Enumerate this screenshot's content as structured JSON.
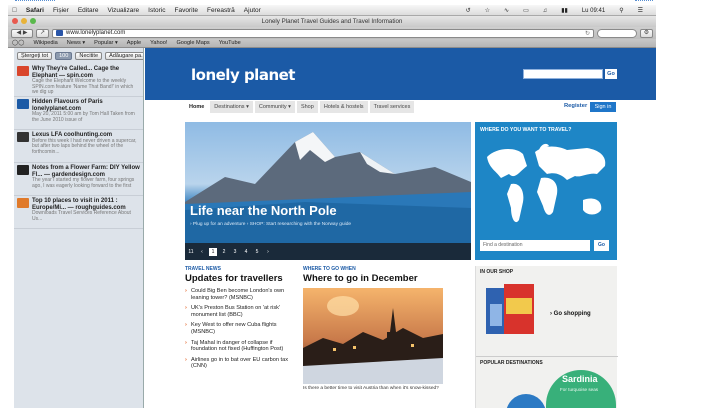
{
  "menubar": {
    "app": "Safari",
    "items": [
      "Fișier",
      "Editare",
      "Vizualizare",
      "Istoric",
      "Favorite",
      "Fereastră",
      "Ajutor"
    ],
    "clock": "Lu 09:41"
  },
  "window": {
    "title": "Lonely Planet Travel Guides and Travel Information"
  },
  "toolbar": {
    "url": "www.lonelyplanet.com"
  },
  "bookmarks": [
    "Wikipedia",
    "News ▾",
    "Popular ▾",
    "Apple",
    "Yahoo!",
    "Google Maps",
    "YouTube"
  ],
  "sidebar": {
    "clear_label": "Ștergeți tot",
    "count": "100",
    "unread_label": "Necitite",
    "add_label": "Adăugare pa...",
    "items": [
      {
        "title": "Why They're Called... Cage the Elephant — spin.com",
        "desc": "Cage the Elephant Welcome to the weekly SPIN.com feature 'Name That Band!' in which we dig up",
        "color": "#d9462c"
      },
      {
        "title": "Hidden Flavours of Paris lonelyplanet.com",
        "desc": "May 20, 2011 5:00 am by Tom Hall Taken from the June 2010 issue of",
        "color": "#1b5aa6"
      },
      {
        "title": "Lexus LFA coolhunting.com",
        "desc": "Before this week I had never driven a supercar, but after two laps behind the wheel of the forthcomin...",
        "color": "#333333"
      },
      {
        "title": "Notes from a Flower Farm: DIY Yellow Fl... — gardendesign.com",
        "desc": "The year I started my flower farm, four springs ago, I was eagerly looking forward to the first",
        "color": "#222222"
      },
      {
        "title": "Top 10 places to visit in 2011 : Europe/Mi... — roughguides.com",
        "desc": "Downloads Travel Services Reference About Us...",
        "color": "#e07a2a"
      }
    ]
  },
  "lp": {
    "logo": "lonely planet",
    "go": "Go",
    "nav": [
      "Home",
      "Destinations ▾",
      "Community ▾",
      "Shop",
      "Hotels & hostels",
      "Travel services"
    ],
    "register": "Register",
    "signin": "Sign in",
    "hero_title": "Life near the North Pole",
    "hero_sub": "› Plug up for an adventure   › SHOP: Start researching with the Norway guide",
    "pager": [
      "11",
      "‹",
      "1",
      "2",
      "3",
      "4",
      "5",
      "›"
    ],
    "map_title": "WHERE DO YOU WANT TO TRAVEL?",
    "dest_placeholder": "Find a destination",
    "travel_news": "Travel news",
    "updates_title": "Updates for travellers",
    "news": [
      "Could Big Ben become London's own leaning tower? (MSNBC)",
      "UK's Preston Bus Station on 'at risk' monument list (BBC)",
      "Key West to offer new Cuba flights (MSNBC)",
      "Taj Mahal in danger of collapse if foundation not fixed (Huffington Post)",
      "Airlines go in to bat over EU carbon tax (CNN)"
    ],
    "where_kicker": "Where to go when",
    "where_title": "Where to go in December",
    "where_caption": "Is there a better time to visit Austria than when it's snow-kissed?",
    "shop_kicker": "In our shop",
    "go_shopping": "› Go shopping",
    "popular": "Popular destinations",
    "sardinia": "Sardinia",
    "sardinia_sub": "For turquoise seas"
  }
}
